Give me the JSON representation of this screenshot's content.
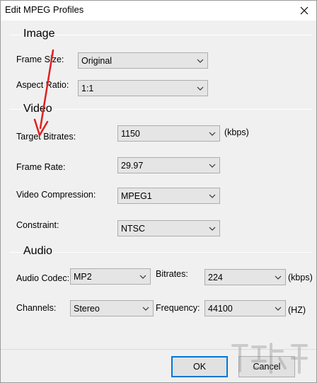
{
  "window": {
    "title": "Edit MPEG Profiles"
  },
  "sections": {
    "image": "Image",
    "video": "Video",
    "audio": "Audio"
  },
  "image": {
    "frame_size_label": "Frame Size:",
    "frame_size_value": "Original",
    "aspect_ratio_label": "Aspect Ratio:",
    "aspect_ratio_value": "1:1"
  },
  "video": {
    "target_bitrates_label": "Target Bitrates:",
    "target_bitrates_value": "1150",
    "target_bitrates_unit": "(kbps)",
    "frame_rate_label": "Frame Rate:",
    "frame_rate_value": "29.97",
    "video_compression_label": "Video Compression:",
    "video_compression_value": "MPEG1",
    "constraint_label": "Constraint:",
    "constraint_value": "NTSC"
  },
  "audio": {
    "audio_codec_label": "Audio Codec:",
    "audio_codec_value": "MP2",
    "bitrates_label": "Bitrates:",
    "bitrates_value": "224",
    "bitrates_unit": "(kbps)",
    "channels_label": "Channels:",
    "channels_value": "Stereo",
    "frequency_label": "Frequency:",
    "frequency_value": "44100",
    "frequency_unit": "(HZ)"
  },
  "buttons": {
    "ok": "OK",
    "cancel": "Cancel"
  },
  "colors": {
    "annotation_arrow": "#e02020",
    "dialog_background": "#f0f0f0",
    "default_button_border": "#0078d7"
  },
  "icons": {
    "close": "close-icon",
    "dropdown": "chevron-down-icon"
  }
}
